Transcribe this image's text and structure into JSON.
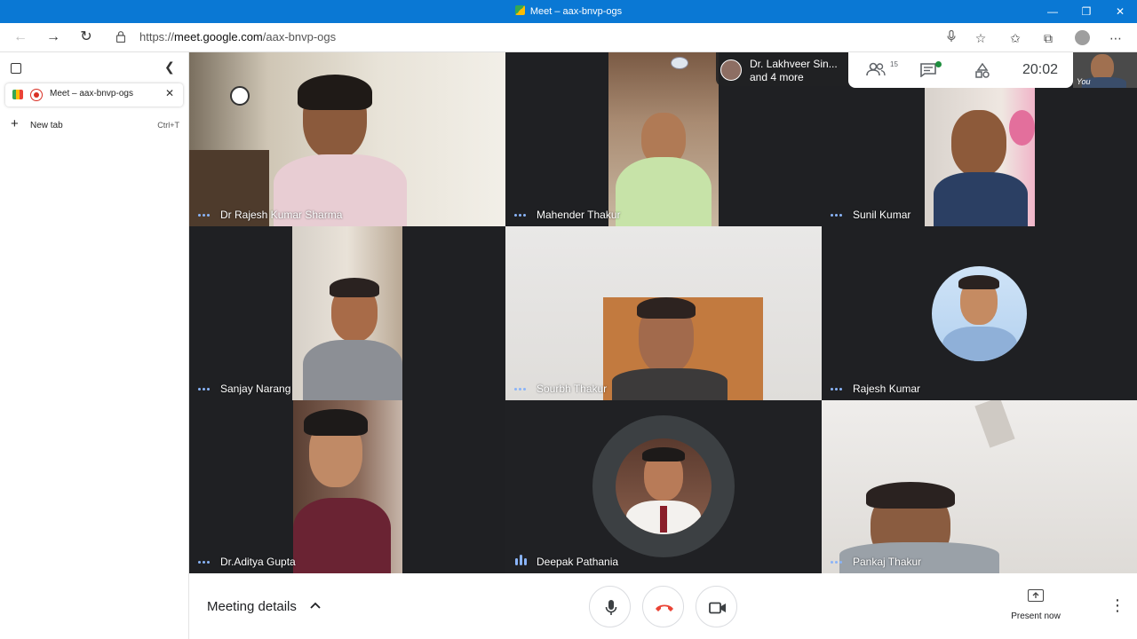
{
  "window": {
    "title": "Meet – aax-bnvp-ogs",
    "controls": {
      "minimize": "—",
      "restore": "❐",
      "close": "✕"
    }
  },
  "addressbar": {
    "url_prefix": "https://",
    "url_domain": "meet.google.com",
    "url_path": "/aax-bnvp-ogs"
  },
  "sidebar": {
    "tabs": [
      {
        "label": "Meet – aax-bnvp-ogs"
      }
    ],
    "new_tab_label": "New tab",
    "new_tab_shortcut": "Ctrl+T"
  },
  "meet": {
    "top_info": {
      "name": "Dr. Lakhveer Sin...",
      "more": "and 4 more"
    },
    "participant_count": "15",
    "clock": "20:02",
    "self_label": "You",
    "participants": [
      {
        "name": "Dr Rajesh Kumar Sharma"
      },
      {
        "name": "Mahender Thakur"
      },
      {
        "name": "Sunil Kumar"
      },
      {
        "name": "Sanjay Narang"
      },
      {
        "name": "Sourbh Thakur"
      },
      {
        "name": "Rajesh Kumar"
      },
      {
        "name": "Dr.Aditya Gupta"
      },
      {
        "name": "Deepak Pathania"
      },
      {
        "name": "Pankaj Thakur"
      }
    ],
    "speaking_participant": "Deepak Pathania"
  },
  "bottombar": {
    "meeting_details": "Meeting details",
    "present_now": "Present now"
  },
  "colors": {
    "accent": "#0a78d4",
    "meet_bg": "#202124",
    "hangup_red": "#ea4335",
    "indicator_blue": "#8ab4f8"
  }
}
